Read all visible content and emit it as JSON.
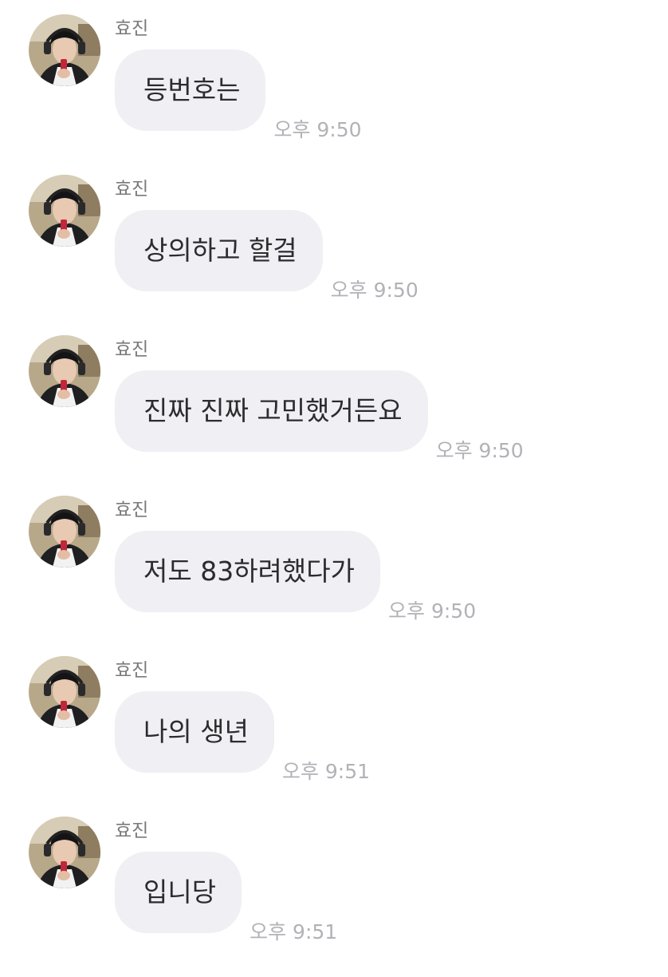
{
  "messages": [
    {
      "sender": "효진",
      "text": "등번호는",
      "time": "오후 9:50"
    },
    {
      "sender": "효진",
      "text": "상의하고 할걸",
      "time": "오후 9:50"
    },
    {
      "sender": "효진",
      "text": "진짜 진짜 고민했거든요",
      "time": "오후 9:50"
    },
    {
      "sender": "효진",
      "text": "저도 83하려했다가",
      "time": "오후 9:50"
    },
    {
      "sender": "효진",
      "text": "나의 생년",
      "time": "오후 9:51"
    },
    {
      "sender": "효진",
      "text": "입니당",
      "time": "오후 9:51"
    }
  ],
  "colors": {
    "bubble": "#efeff4",
    "message_text": "#2c2c2e",
    "sender_name": "#7a7a7d",
    "timestamp": "#b2b2b7",
    "background": "#ffffff"
  },
  "icons": {
    "avatar": "profile-photo-avatar-icon"
  }
}
